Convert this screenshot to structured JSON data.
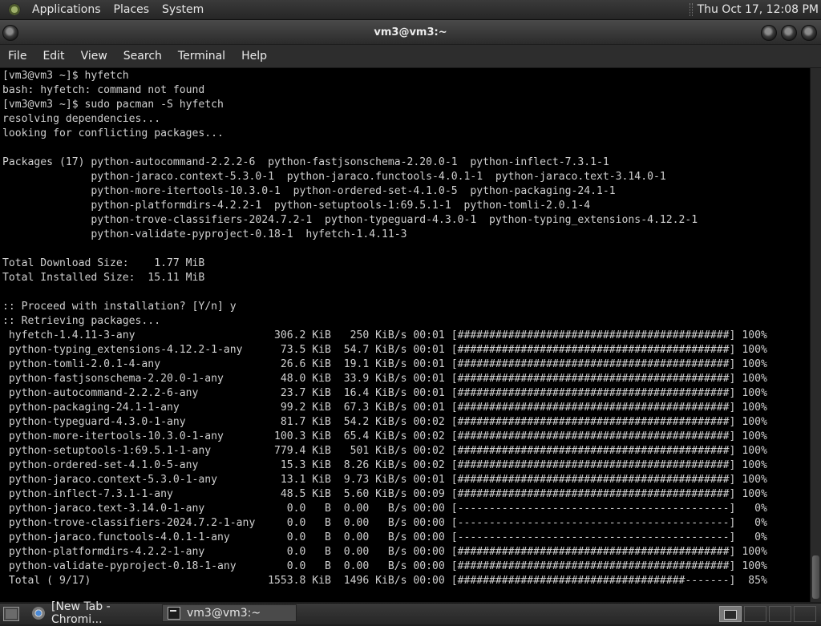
{
  "top_panel": {
    "menus": [
      "Applications",
      "Places",
      "System"
    ],
    "clock": "Thu Oct 17, 12:08 PM"
  },
  "window": {
    "title": "vm3@vm3:~"
  },
  "menubar": {
    "items": [
      "File",
      "Edit",
      "View",
      "Search",
      "Terminal",
      "Help"
    ]
  },
  "terminal": {
    "lines": [
      "[vm3@vm3 ~]$ hyfetch",
      "bash: hyfetch: command not found",
      "[vm3@vm3 ~]$ sudo pacman -S hyfetch",
      "resolving dependencies...",
      "looking for conflicting packages...",
      "",
      "Packages (17) python-autocommand-2.2.2-6  python-fastjsonschema-2.20.0-1  python-inflect-7.3.1-1",
      "              python-jaraco.context-5.3.0-1  python-jaraco.functools-4.0.1-1  python-jaraco.text-3.14.0-1",
      "              python-more-itertools-10.3.0-1  python-ordered-set-4.1.0-5  python-packaging-24.1-1",
      "              python-platformdirs-4.2.2-1  python-setuptools-1:69.5.1-1  python-tomli-2.0.1-4",
      "              python-trove-classifiers-2024.7.2-1  python-typeguard-4.3.0-1  python-typing_extensions-4.12.2-1",
      "              python-validate-pyproject-0.18-1  hyfetch-1.4.11-3",
      "",
      "Total Download Size:    1.77 MiB",
      "Total Installed Size:  15.11 MiB",
      "",
      ":: Proceed with installation? [Y/n] y",
      ":: Retrieving packages...",
      " hyfetch-1.4.11-3-any                      306.2 KiB   250 KiB/s 00:01 [###########################################] 100%",
      " python-typing_extensions-4.12.2-1-any      73.5 KiB  54.7 KiB/s 00:01 [###########################################] 100%",
      " python-tomli-2.0.1-4-any                   26.6 KiB  19.1 KiB/s 00:01 [###########################################] 100%",
      " python-fastjsonschema-2.20.0-1-any         48.0 KiB  33.9 KiB/s 00:01 [###########################################] 100%",
      " python-autocommand-2.2.2-6-any             23.7 KiB  16.4 KiB/s 00:01 [###########################################] 100%",
      " python-packaging-24.1-1-any                99.2 KiB  67.3 KiB/s 00:01 [###########################################] 100%",
      " python-typeguard-4.3.0-1-any               81.7 KiB  54.2 KiB/s 00:02 [###########################################] 100%",
      " python-more-itertools-10.3.0-1-any        100.3 KiB  65.4 KiB/s 00:02 [###########################################] 100%",
      " python-setuptools-1:69.5.1-1-any          779.4 KiB   501 KiB/s 00:02 [###########################################] 100%",
      " python-ordered-set-4.1.0-5-any             15.3 KiB  8.26 KiB/s 00:02 [###########################################] 100%",
      " python-jaraco.context-5.3.0-1-any          13.1 KiB  9.73 KiB/s 00:01 [###########################################] 100%",
      " python-inflect-7.3.1-1-any                 48.5 KiB  5.60 KiB/s 00:09 [###########################################] 100%",
      " python-jaraco.text-3.14.0-1-any             0.0   B  0.00   B/s 00:00 [-------------------------------------------]   0%",
      " python-trove-classifiers-2024.7.2-1-any     0.0   B  0.00   B/s 00:00 [-------------------------------------------]   0%",
      " python-jaraco.functools-4.0.1-1-any         0.0   B  0.00   B/s 00:00 [-------------------------------------------]   0%",
      " python-platformdirs-4.2.2-1-any             0.0   B  0.00   B/s 00:00 [###########################################] 100%",
      " python-validate-pyproject-0.18-1-any        0.0   B  0.00   B/s 00:00 [###########################################] 100%",
      " Total ( 9/17)                            1553.8 KiB  1496 KiB/s 00:00 [####################################-------]  85%"
    ]
  },
  "taskbar": {
    "tasks": [
      {
        "label": "[New Tab - Chromi...",
        "icon": "chromium-icon",
        "active": false
      },
      {
        "label": "vm3@vm3:~",
        "icon": "terminal-icon",
        "active": true
      }
    ],
    "workspaces": 4
  }
}
